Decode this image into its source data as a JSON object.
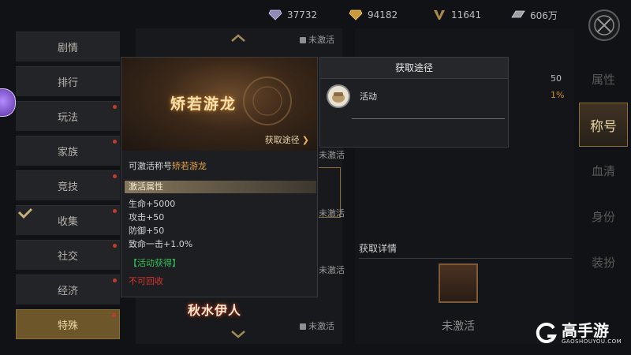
{
  "currency": [
    {
      "icon": "purple-diamond-icon",
      "value": "37732",
      "color": "#8f8ab8"
    },
    {
      "icon": "gold-diamond-icon",
      "value": "94182",
      "color": "#c99a3c"
    },
    {
      "icon": "v-emblem-icon",
      "value": "11641",
      "color": "#a8894a"
    },
    {
      "icon": "silver-ingot-icon",
      "value": "606万",
      "color": "#9aa0a6"
    }
  ],
  "nav": [
    {
      "label": "剧情",
      "dot": false
    },
    {
      "label": "排行",
      "dot": false
    },
    {
      "label": "玩法",
      "dot": true
    },
    {
      "label": "家族",
      "dot": true
    },
    {
      "label": "竞技",
      "dot": true
    },
    {
      "label": "收集",
      "dot": true,
      "checked": true
    },
    {
      "label": "社交",
      "dot": true
    },
    {
      "label": "经济",
      "dot": true
    },
    {
      "label": "特殊",
      "dot": true,
      "active": true
    }
  ],
  "right_tabs": [
    {
      "label": "属性",
      "active": false
    },
    {
      "label": "称号",
      "active": true
    },
    {
      "label": "血清",
      "active": false
    },
    {
      "label": "身份",
      "active": false
    },
    {
      "label": "装扮",
      "active": false
    }
  ],
  "card": {
    "banner_title": "矫若游龙",
    "obtain_link": "获取途径",
    "activatable_prefix": "可激活称号",
    "activatable_title": "矫若游龙",
    "attr_header": "激活属性",
    "attrs": [
      "生命+5000",
      "攻击+50",
      "防御+50",
      "致命一击+1.0%"
    ],
    "source": "【活动获得】",
    "recycle": "不可回收"
  },
  "route_panel": {
    "title": "获取途径",
    "item_label": "活动"
  },
  "middle": {
    "inactive_top": "未激活",
    "inactive_a": "未激活",
    "inactive_b": "未激活",
    "inactive_bottom": "未激活",
    "bottom_title": "秋水伊人",
    "detail_header": "获取详情",
    "detail_status": "未激活",
    "stat_value": "50",
    "stat_pct": "1%"
  },
  "watermark": {
    "brand": "高手游",
    "url": "GAOSHOUYOU.COM"
  }
}
